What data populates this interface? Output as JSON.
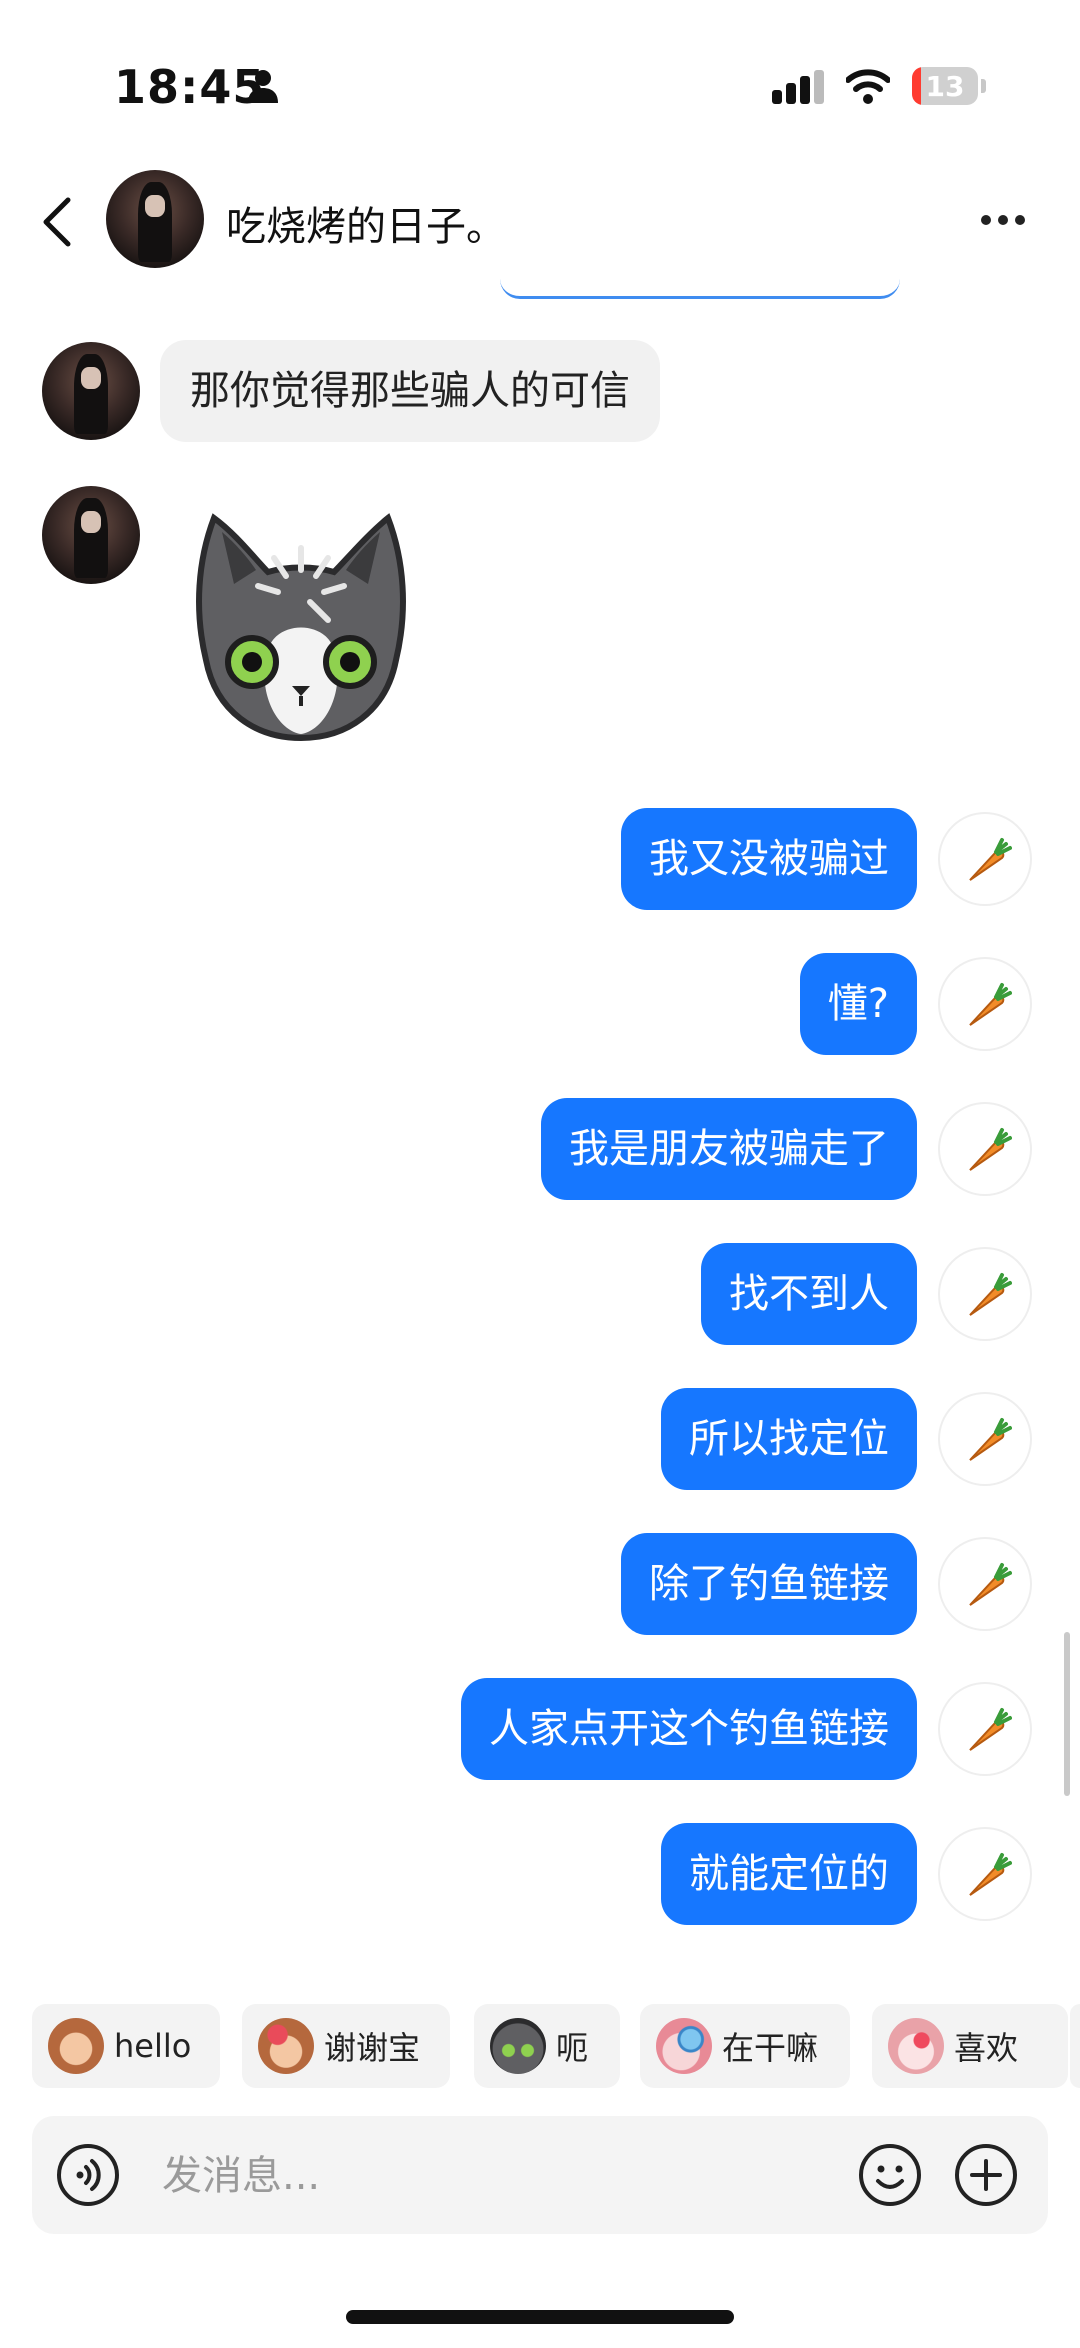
{
  "status_bar": {
    "time": "18:45",
    "battery": "13",
    "battery_level": 0.13,
    "icons": [
      "person-icon",
      "signal-icon",
      "wifi-icon",
      "battery-icon"
    ]
  },
  "header": {
    "title": "吃烧烤的日子。",
    "icons": [
      "back-icon",
      "avatar",
      "more-icon"
    ]
  },
  "incoming": {
    "text_message": "那你觉得那些骗人的可信",
    "sticker": "cat-sticker"
  },
  "outgoing_messages": [
    "我又没被骗过",
    "懂?",
    "我是朋友被骗走了",
    "找不到人",
    "所以找定位",
    "除了钓鱼链接",
    "人家点开这个钓鱼链接",
    "就能定位的"
  ],
  "message_action_icon": "carrot-icon",
  "quick_replies": [
    {
      "label": "hello",
      "icon": "monkey-sticker-icon"
    },
    {
      "label": "谢谢宝",
      "icon": "monkey-flower-sticker-icon"
    },
    {
      "label": "呃",
      "icon": "cat-sticker-icon"
    },
    {
      "label": "在干嘛",
      "icon": "magnifier-sticker-icon"
    },
    {
      "label": "喜欢",
      "icon": "heart-sticker-icon"
    }
  ],
  "input": {
    "placeholder": "发消息...",
    "value": "",
    "icons": [
      "voice-icon",
      "emoji-icon",
      "plus-icon"
    ]
  },
  "colors": {
    "outgoing_bubble": "#1677ff",
    "incoming_bubble": "#f1f1f1",
    "battery_low": "#ff3b30"
  }
}
